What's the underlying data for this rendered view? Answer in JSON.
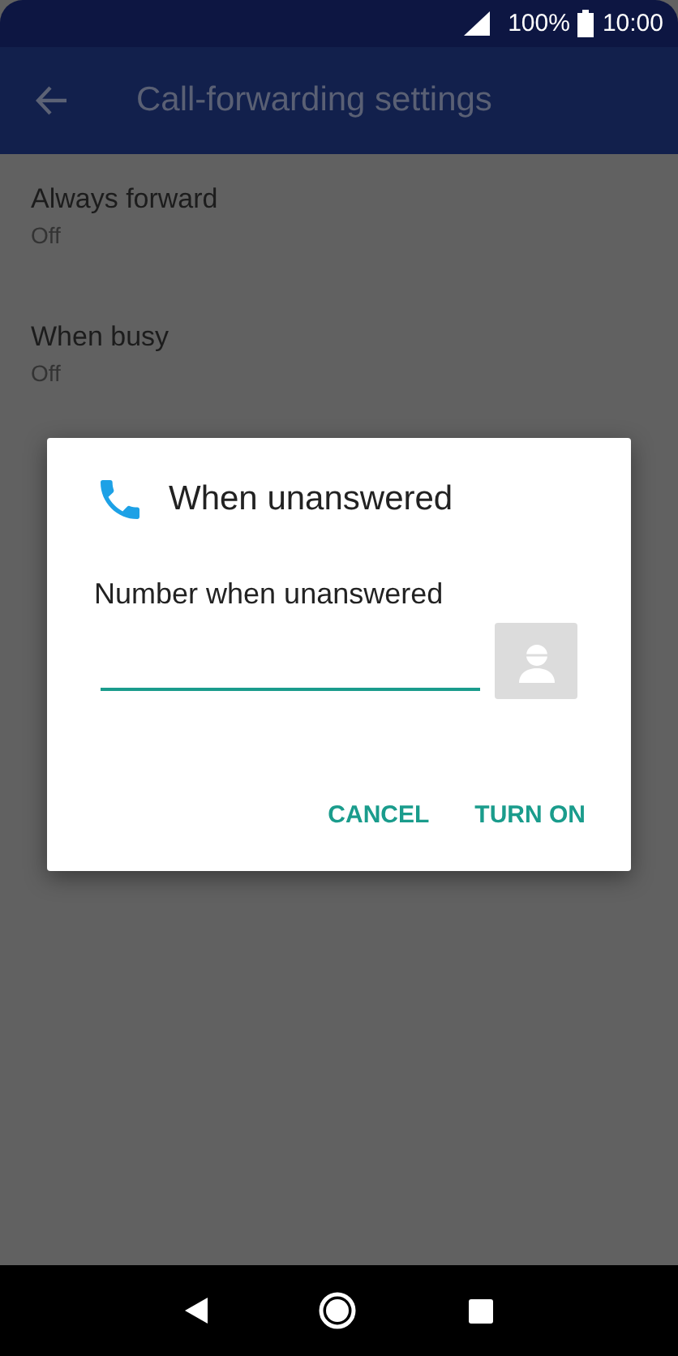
{
  "status_bar": {
    "battery": "100%",
    "time": "10:00"
  },
  "app_bar": {
    "title": "Call-forwarding settings"
  },
  "settings": [
    {
      "label": "Always forward",
      "value": "Off"
    },
    {
      "label": "When busy",
      "value": "Off"
    }
  ],
  "dialog": {
    "title": "When unanswered",
    "field_label": "Number when unanswered",
    "buttons": [
      "CANCEL",
      "TURN ON"
    ]
  }
}
